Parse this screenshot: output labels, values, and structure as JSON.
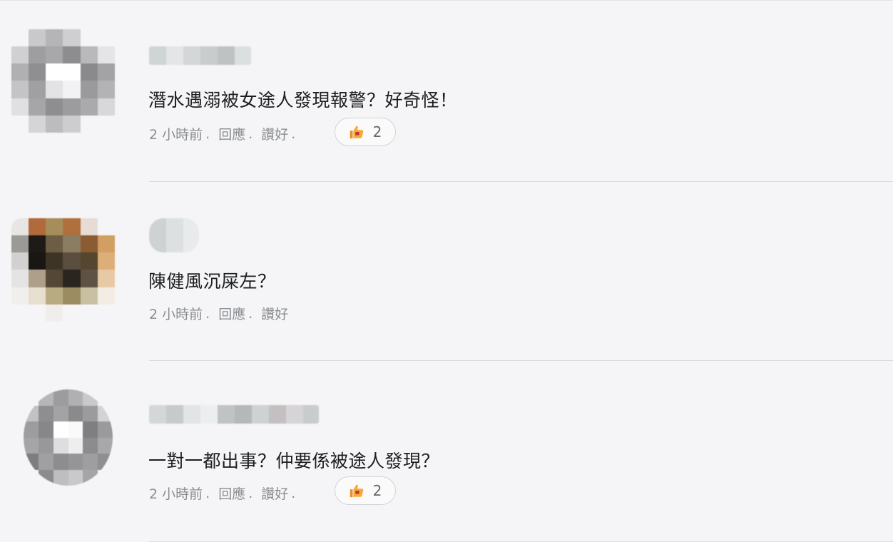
{
  "comments": [
    {
      "text": "潛水遇溺被女途人發現報警？好奇怪！",
      "time": "2 小時前",
      "reply_label": "回應",
      "like_label": "讚好",
      "like_count": "2",
      "like_icon": "thumbs-up-icon",
      "colors": {
        "like_icon": "#f0a030"
      }
    },
    {
      "text": "陳健風沉屎左？",
      "time": "2 小時前",
      "reply_label": "回應",
      "like_label": "讚好"
    },
    {
      "text": "一對一都出事？仲要係被途人發現？",
      "time": "2 小時前",
      "reply_label": "回應",
      "like_label": "讚好",
      "like_count": "2",
      "like_icon": "thumbs-up-icon",
      "colors": {
        "like_icon": "#f0a030"
      }
    }
  ],
  "separator": "."
}
